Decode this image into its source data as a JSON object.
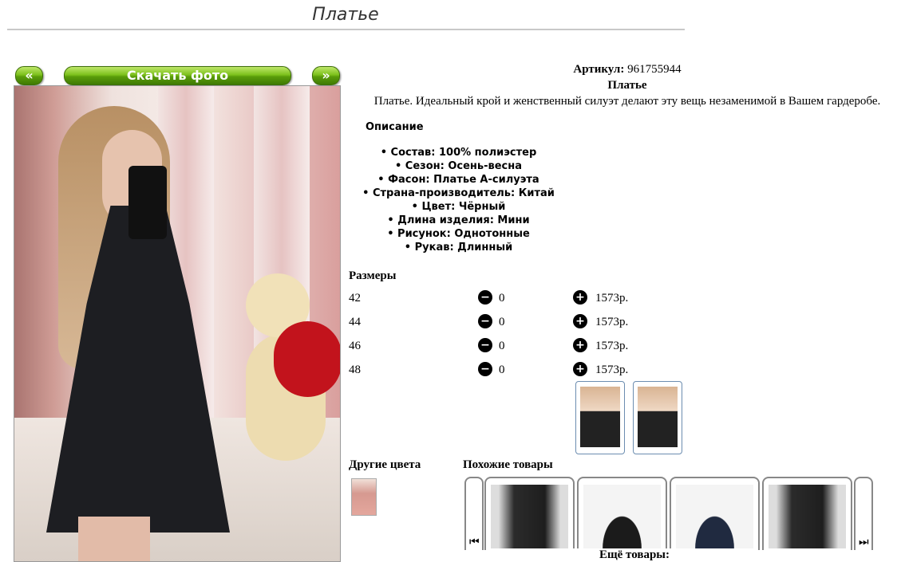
{
  "page": {
    "title": "Платье"
  },
  "gallery": {
    "prev_label": "«",
    "download_label": "Скачать фото",
    "next_label": "»"
  },
  "product": {
    "article_label": "Артикул:",
    "article_value": "961755944",
    "name": "Платье",
    "text": "Платье. Идеальный крой и женственный силуэт делают эту вещь незаменимой в Вашем гардеробе."
  },
  "description": {
    "title": "Описание",
    "items": [
      "Состав: 100% полиэстер",
      "Сезон: Осень-весна",
      "Фасон: Платье А-силуэта",
      "Страна-производитель: Китай",
      "Цвет: Чёрный",
      "Длина изделия: Мини",
      "Рисунок: Однотонные",
      "Рукав: Длинный"
    ]
  },
  "sizes": {
    "title": "Размеры",
    "minus_icon": "−",
    "plus_icon": "+",
    "rows": [
      {
        "size": "42",
        "qty": "0",
        "price": "1573р."
      },
      {
        "size": "44",
        "qty": "0",
        "price": "1573р."
      },
      {
        "size": "46",
        "qty": "0",
        "price": "1573р."
      },
      {
        "size": "48",
        "qty": "0",
        "price": "1573р."
      }
    ]
  },
  "other_colors": {
    "title": "Другие цвета"
  },
  "similar": {
    "title": "Похожие товары",
    "prev_icon": "⏮",
    "next_icon": "⏭",
    "more_label": "Ещё товары:"
  },
  "icons": {
    "minus": "minus-circle-icon",
    "plus": "plus-circle-icon",
    "carousel_prev": "skip-back-icon",
    "carousel_next": "skip-forward-icon"
  },
  "colors": {
    "button_green": "#6fb314",
    "thumb_border": "#6c8db0"
  }
}
